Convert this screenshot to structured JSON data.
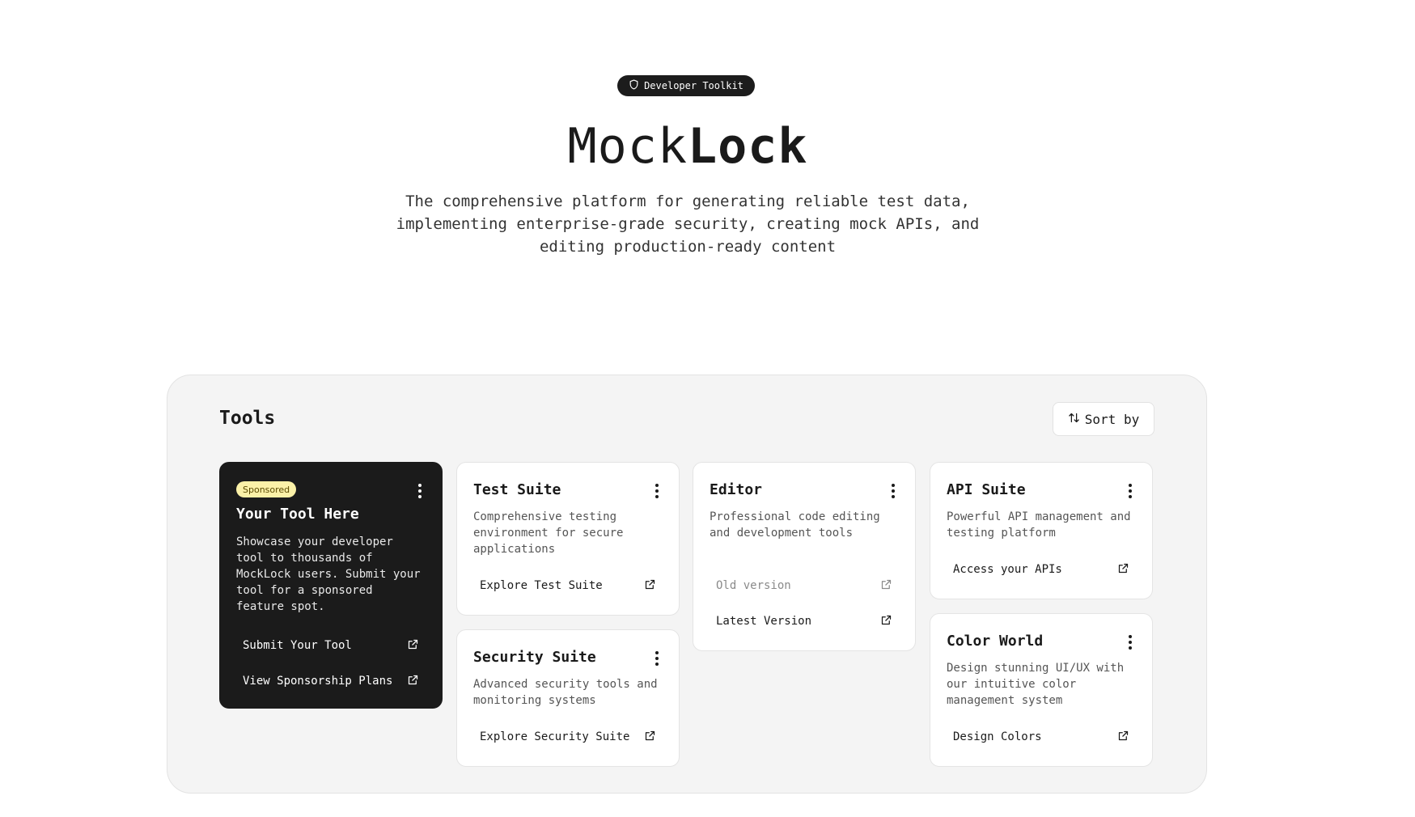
{
  "hero": {
    "badge": "Developer Toolkit",
    "title_light": "Mock",
    "title_bold": "Lock",
    "subtitle": "The comprehensive platform for generating reliable test data, implementing enterprise-grade security, creating mock APIs, and editing production-ready content"
  },
  "tools": {
    "heading": "Tools",
    "sort_label": "Sort by",
    "sponsored": {
      "tag": "Sponsored",
      "name": "Your Tool Here",
      "description": "Showcase your developer tool to thousands of MockLock users. Submit your tool for a sponsored feature spot.",
      "links": [
        "Submit Your Tool",
        "View Sponsorship Plans"
      ]
    },
    "test_suite": {
      "name": "Test Suite",
      "description": "Comprehensive testing environment for secure applications",
      "link": "Explore Test Suite"
    },
    "security_suite": {
      "name": "Security Suite",
      "description": "Advanced security tools and monitoring systems",
      "link": "Explore Security Suite"
    },
    "editor": {
      "name": "Editor",
      "description": "Professional code editing and development tools",
      "links": [
        "Old version",
        "Latest Version"
      ]
    },
    "api_suite": {
      "name": "API Suite",
      "description": "Powerful API management and testing platform",
      "link": "Access your APIs"
    },
    "color_world": {
      "name": "Color World",
      "description": "Design stunning UI/UX with our intuitive color management system",
      "link": "Design Colors"
    }
  }
}
